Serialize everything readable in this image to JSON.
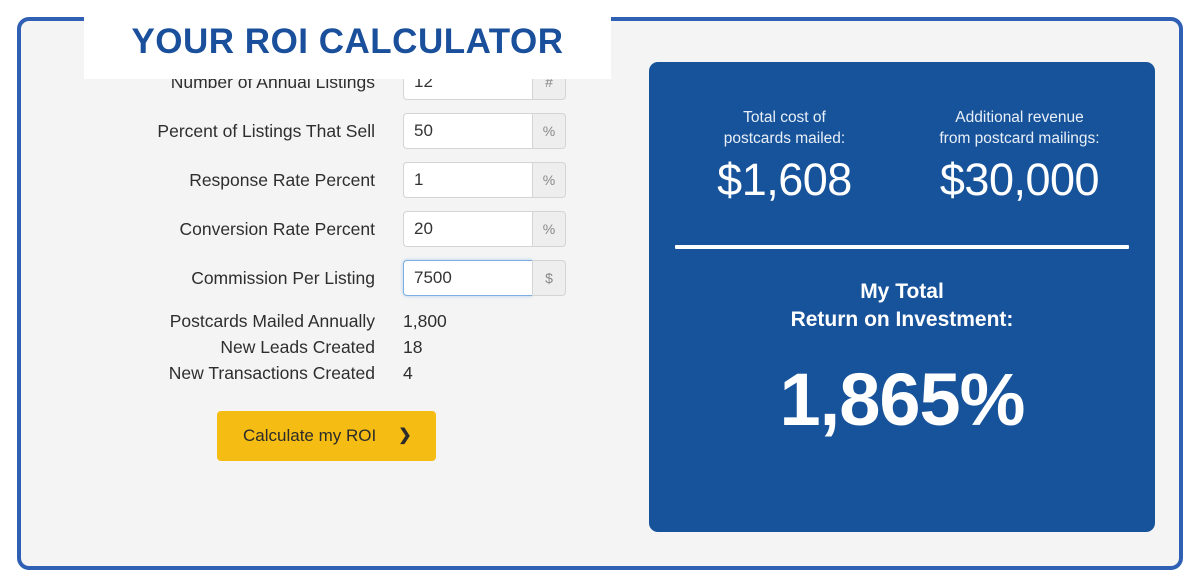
{
  "header": {
    "title": "YOUR ROI CALCULATOR",
    "title_color": "#1a4f9c"
  },
  "theme": {
    "border_blue": "#2f60b4",
    "panel_blue": "#17539b",
    "cta_amber": "#f5bc14",
    "card_background": "#f4f4f4",
    "focus_blue": "#7cb0e2"
  },
  "form": {
    "fields": [
      {
        "label": "Number of Annual Listings",
        "value": "12",
        "unit": "#",
        "focused": false
      },
      {
        "label": "Percent of Listings That Sell",
        "value": "50",
        "unit": "%",
        "focused": false
      },
      {
        "label": "Response Rate Percent",
        "value": "1",
        "unit": "%",
        "focused": false
      },
      {
        "label": "Conversion Rate Percent",
        "value": "20",
        "unit": "%",
        "focused": false
      },
      {
        "label": "Commission Per Listing",
        "value": "7500",
        "unit": "$",
        "focused": true
      }
    ],
    "computed": [
      {
        "label": "Postcards Mailed Annually",
        "value": "1,800"
      },
      {
        "label": "New Leads Created",
        "value": "18"
      },
      {
        "label": "New Transactions Created",
        "value": "4"
      }
    ],
    "cta": {
      "label": "Calculate my ROI",
      "chevron": "❯"
    }
  },
  "results": {
    "cost": {
      "caption": "Total cost of\npostcards mailed:",
      "amount": "$1,608"
    },
    "revenue": {
      "caption": "Additional revenue\nfrom postcard mailings:",
      "amount": "$30,000"
    },
    "roi": {
      "heading": "My Total\nReturn on Investment:",
      "value": "1,865%"
    }
  }
}
